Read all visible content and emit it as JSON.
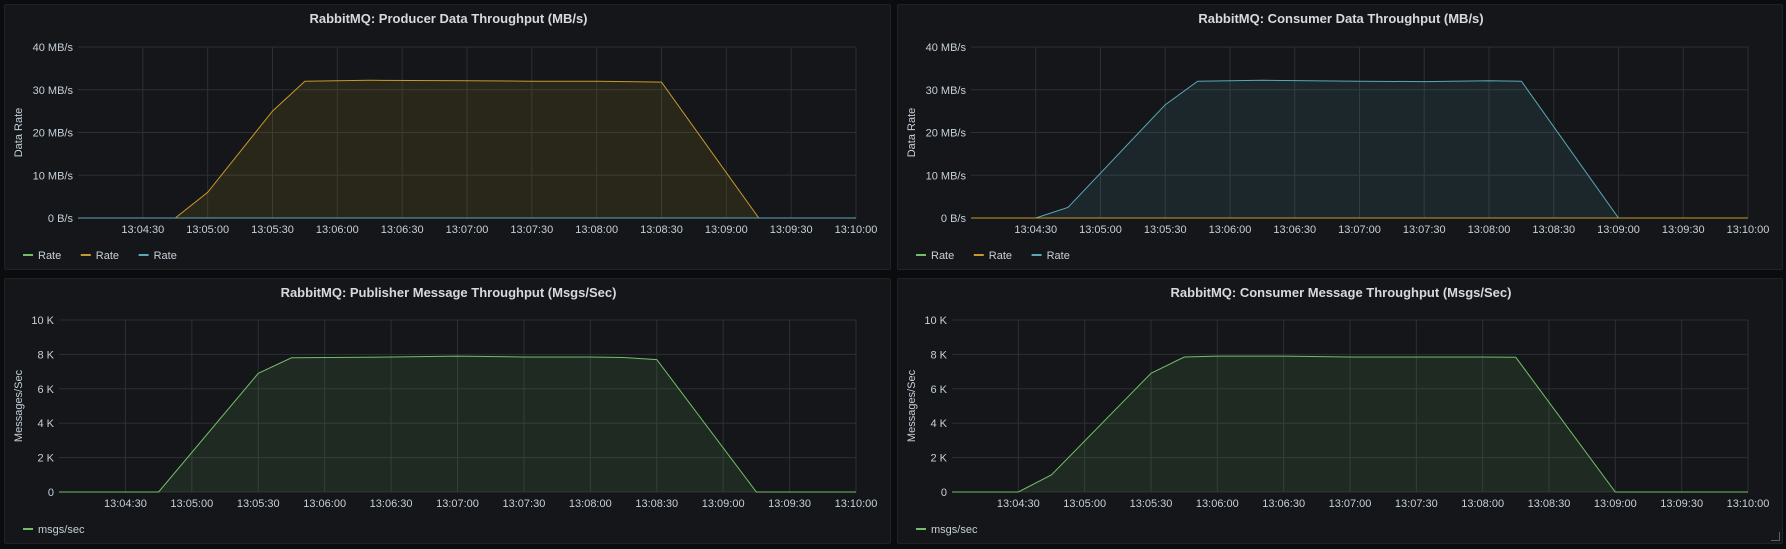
{
  "colors": {
    "green": "#73bf69",
    "yellow": "#e0b400",
    "yellow_line": "#c79a2a",
    "blue": "#5ba8b8"
  },
  "chart_data": [
    {
      "title": "RabbitMQ: Producer Data Throughput (MB/s)",
      "type": "area",
      "ylabel": "Data Rate",
      "ylim": [
        0,
        40
      ],
      "yticks": [
        "0 B/s",
        "10 MB/s",
        "20 MB/s",
        "30 MB/s",
        "40 MB/s"
      ],
      "x_domain": [
        "13:04:00",
        "13:10:00"
      ],
      "xticks": [
        "13:04:30",
        "13:05:00",
        "13:05:30",
        "13:06:00",
        "13:06:30",
        "13:07:00",
        "13:07:30",
        "13:08:00",
        "13:08:30",
        "13:09:00",
        "13:09:30",
        "13:10:00"
      ],
      "series": [
        {
          "name": "Rate",
          "color": "green",
          "x": [
            "13:04:00",
            "13:10:00"
          ],
          "values": [
            0,
            0
          ],
          "fill": false
        },
        {
          "name": "Rate",
          "color": "yellow",
          "x": [
            "13:04:00",
            "13:04:45",
            "13:05:00",
            "13:05:30",
            "13:05:45",
            "13:06:15",
            "13:07:00",
            "13:07:30",
            "13:08:00",
            "13:08:30",
            "13:09:15",
            "13:10:00"
          ],
          "values": [
            0,
            0,
            6,
            25,
            32,
            32.2,
            32.1,
            32,
            32,
            31.8,
            0,
            0
          ],
          "fill": true
        },
        {
          "name": "Rate",
          "color": "blue",
          "x": [
            "13:04:00",
            "13:10:00"
          ],
          "values": [
            0,
            0
          ],
          "fill": false
        }
      ],
      "legend": [
        "Rate",
        "Rate",
        "Rate"
      ],
      "legend_colors": [
        "green",
        "yellow",
        "blue"
      ]
    },
    {
      "title": "RabbitMQ: Consumer Data Throughput (MB/s)",
      "type": "area",
      "ylabel": "Data Rate",
      "ylim": [
        0,
        40
      ],
      "yticks": [
        "0 B/s",
        "10 MB/s",
        "20 MB/s",
        "30 MB/s",
        "40 MB/s"
      ],
      "x_domain": [
        "13:04:00",
        "13:10:00"
      ],
      "xticks": [
        "13:04:30",
        "13:05:00",
        "13:05:30",
        "13:06:00",
        "13:06:30",
        "13:07:00",
        "13:07:30",
        "13:08:00",
        "13:08:30",
        "13:09:00",
        "13:09:30",
        "13:10:00"
      ],
      "series": [
        {
          "name": "Rate",
          "color": "green",
          "x": [
            "13:04:00",
            "13:10:00"
          ],
          "values": [
            0,
            0
          ],
          "fill": false
        },
        {
          "name": "Rate",
          "color": "yellow",
          "x": [
            "13:04:00",
            "13:10:00"
          ],
          "values": [
            0,
            0
          ],
          "fill": false
        },
        {
          "name": "Rate",
          "color": "blue",
          "x": [
            "13:04:00",
            "13:04:30",
            "13:04:45",
            "13:05:30",
            "13:05:45",
            "13:06:15",
            "13:07:00",
            "13:07:30",
            "13:08:00",
            "13:08:15",
            "13:09:00",
            "13:10:00"
          ],
          "values": [
            0,
            0,
            2.5,
            26.5,
            32,
            32.2,
            32,
            31.9,
            32.1,
            32,
            0,
            0
          ],
          "fill": true
        }
      ],
      "legend": [
        "Rate",
        "Rate",
        "Rate"
      ],
      "legend_colors": [
        "green",
        "yellow",
        "blue"
      ]
    },
    {
      "title": "RabbitMQ: Publisher Message Throughput (Msgs/Sec)",
      "type": "area",
      "ylabel": "Messages/Sec",
      "ylim": [
        0,
        10000
      ],
      "yticks": [
        "0",
        "2 K",
        "4 K",
        "6 K",
        "8 K",
        "10 K"
      ],
      "x_domain": [
        "13:04:00",
        "13:10:00"
      ],
      "xticks": [
        "13:04:30",
        "13:05:00",
        "13:05:30",
        "13:06:00",
        "13:06:30",
        "13:07:00",
        "13:07:30",
        "13:08:00",
        "13:08:30",
        "13:09:00",
        "13:09:30",
        "13:10:00"
      ],
      "series": [
        {
          "name": "msgs/sec",
          "color": "green",
          "x": [
            "13:04:00",
            "13:04:45",
            "13:05:30",
            "13:05:45",
            "13:06:30",
            "13:07:00",
            "13:07:30",
            "13:08:00",
            "13:08:15",
            "13:08:30",
            "13:09:15",
            "13:10:00"
          ],
          "values": [
            0,
            0,
            6900,
            7800,
            7850,
            7900,
            7850,
            7850,
            7820,
            7700,
            0,
            0
          ],
          "fill": true
        }
      ],
      "legend": [
        "msgs/sec"
      ],
      "legend_colors": [
        "green"
      ]
    },
    {
      "title": "RabbitMQ: Consumer Message Throughput (Msgs/Sec)",
      "type": "area",
      "ylabel": "Messages/Sec",
      "ylim": [
        0,
        10000
      ],
      "yticks": [
        "0",
        "2 K",
        "4 K",
        "6 K",
        "8 K",
        "10 K"
      ],
      "x_domain": [
        "13:04:00",
        "13:10:00"
      ],
      "xticks": [
        "13:04:30",
        "13:05:00",
        "13:05:30",
        "13:06:00",
        "13:06:30",
        "13:07:00",
        "13:07:30",
        "13:08:00",
        "13:08:30",
        "13:09:00",
        "13:09:30",
        "13:10:00"
      ],
      "series": [
        {
          "name": "msgs/sec",
          "color": "green",
          "x": [
            "13:04:00",
            "13:04:30",
            "13:04:45",
            "13:05:30",
            "13:05:45",
            "13:06:00",
            "13:06:30",
            "13:07:00",
            "13:07:30",
            "13:08:00",
            "13:08:15",
            "13:09:00",
            "13:10:00"
          ],
          "values": [
            0,
            0,
            1000,
            6900,
            7850,
            7900,
            7900,
            7850,
            7850,
            7850,
            7830,
            0,
            0
          ],
          "fill": true
        }
      ],
      "legend": [
        "msgs/sec"
      ],
      "legend_colors": [
        "green"
      ]
    }
  ]
}
